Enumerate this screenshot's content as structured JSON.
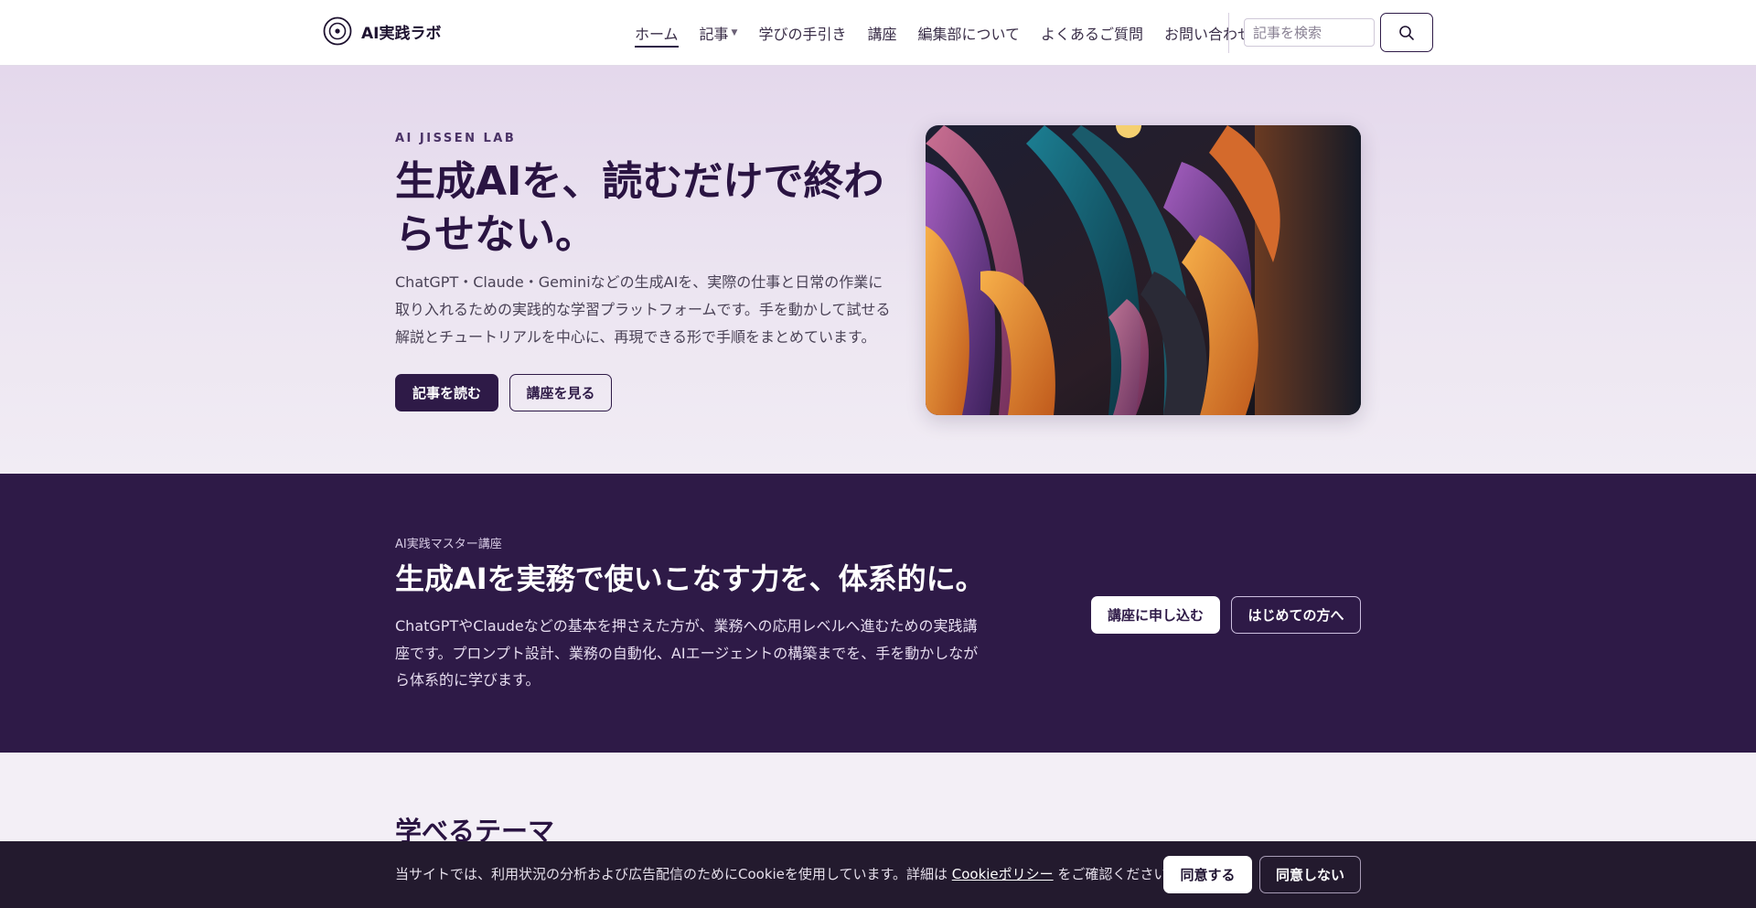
{
  "header": {
    "brand_name": "AI実践ラボ",
    "logo_icon": "target-circle-icon",
    "nav": [
      {
        "label": "ホーム",
        "active": true
      },
      {
        "label": "記事",
        "has_dropdown": true
      },
      {
        "label": "学びの手引き"
      },
      {
        "label": "講座"
      },
      {
        "label": "編集部について"
      },
      {
        "label": "よくあるご質問"
      },
      {
        "label": "お問い合わせ"
      }
    ],
    "search_placeholder": "記事を検索",
    "search_icon": "search-icon"
  },
  "hero": {
    "eyebrow": "AI JISSEN LAB",
    "title": "生成AIを、読むだけで終わらせない。",
    "description": "ChatGPT・Claude・Geminiなどの生成AIを、実際の仕事と日常の作業に取り入れるための実践的な学習プラットフォームです。手を動かして試せる解説とチュートリアルを中心に、再現できる形で手順をまとめています。",
    "primary_button": "記事を読む",
    "secondary_button": "講座を見る"
  },
  "course": {
    "eyebrow": "AI実践マスター講座",
    "title": "生成AIを実務で使いこなす力を、体系的に。",
    "description": "ChatGPTやClaudeなどの基本を押さえた方が、業務への応用レベルへ進むための実践講座です。プロンプト設計、業務の自動化、AIエージェントの構築までを、手を動かしながら体系的に学びます。",
    "apply_button": "講座に申し込む",
    "beginner_button": "はじめての方へ"
  },
  "themes": {
    "title": "学べるテーマ"
  },
  "cookie": {
    "text_before": "当サイトでは、利用状況の分析および広告配信のためにCookieを使用しています。詳細は ",
    "link": "Cookieポリシー",
    "text_after": " をご確認ください。",
    "accept": "同意する",
    "decline": "同意しない"
  },
  "colors": {
    "primary": "#2e1a47",
    "hero_bg": "#e4d8ec",
    "cookie_bg": "#231a2e"
  }
}
